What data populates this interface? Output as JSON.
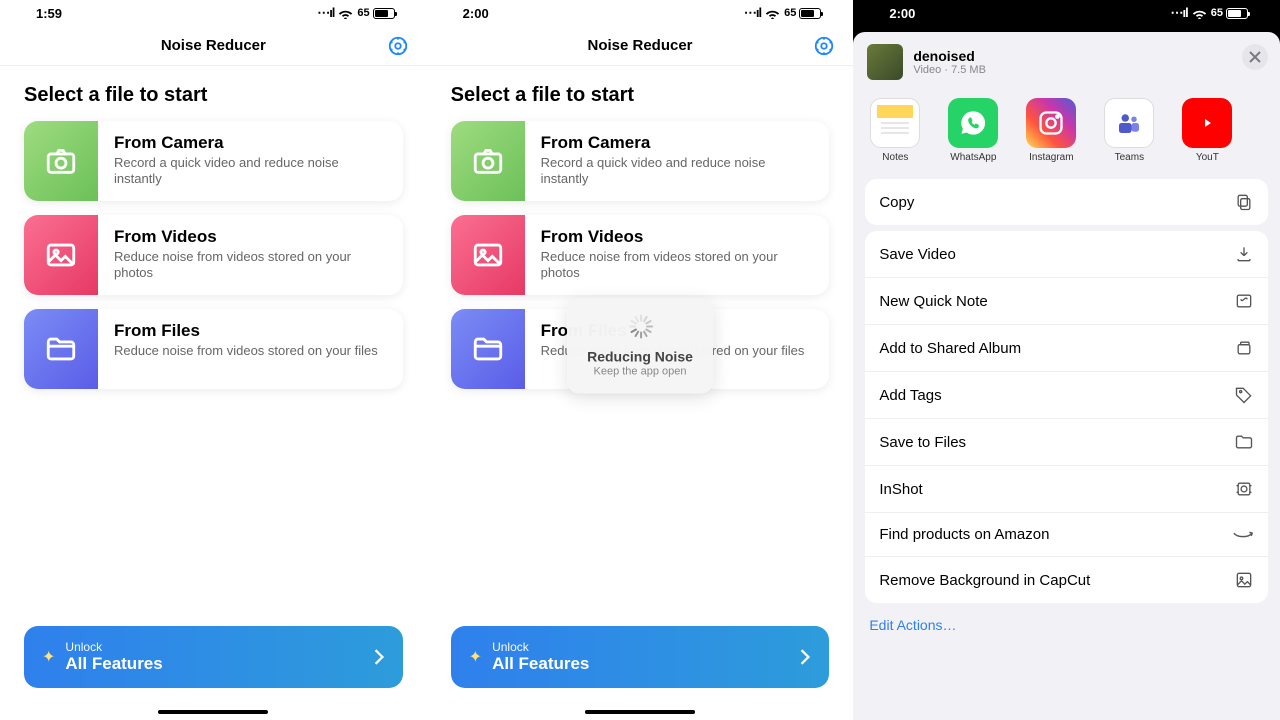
{
  "status": {
    "time1": "1:59",
    "time2": "2:00",
    "time3": "2:00",
    "battery": "65"
  },
  "app": {
    "title": "Noise Reducer",
    "select_heading": "Select a file to start",
    "cards": {
      "camera": {
        "title": "From Camera",
        "desc": "Record a quick video and reduce noise instantly"
      },
      "videos": {
        "title": "From Videos",
        "desc": "Reduce noise from videos stored on your photos"
      },
      "files": {
        "title": "From Files",
        "desc": "Reduce noise from videos stored on your files"
      }
    },
    "unlock": {
      "small": "Unlock",
      "big": "All Features"
    },
    "overlay": {
      "title": "Reducing Noise",
      "sub": "Keep the app open"
    }
  },
  "share": {
    "file": {
      "name": "denoised",
      "type": "Video",
      "size": "7.5 MB"
    },
    "targets": {
      "notes": "Notes",
      "whatsapp": "WhatsApp",
      "instagram": "Instagram",
      "teams": "Teams",
      "youtube": "YouT"
    },
    "actions": {
      "copy": "Copy",
      "save_video": "Save Video",
      "new_quick_note": "New Quick Note",
      "shared_album": "Add to Shared Album",
      "add_tags": "Add Tags",
      "save_files": "Save to Files",
      "inshot": "InShot",
      "amazon": "Find products on Amazon",
      "capcut": "Remove Background in CapCut"
    },
    "edit": "Edit Actions…"
  }
}
